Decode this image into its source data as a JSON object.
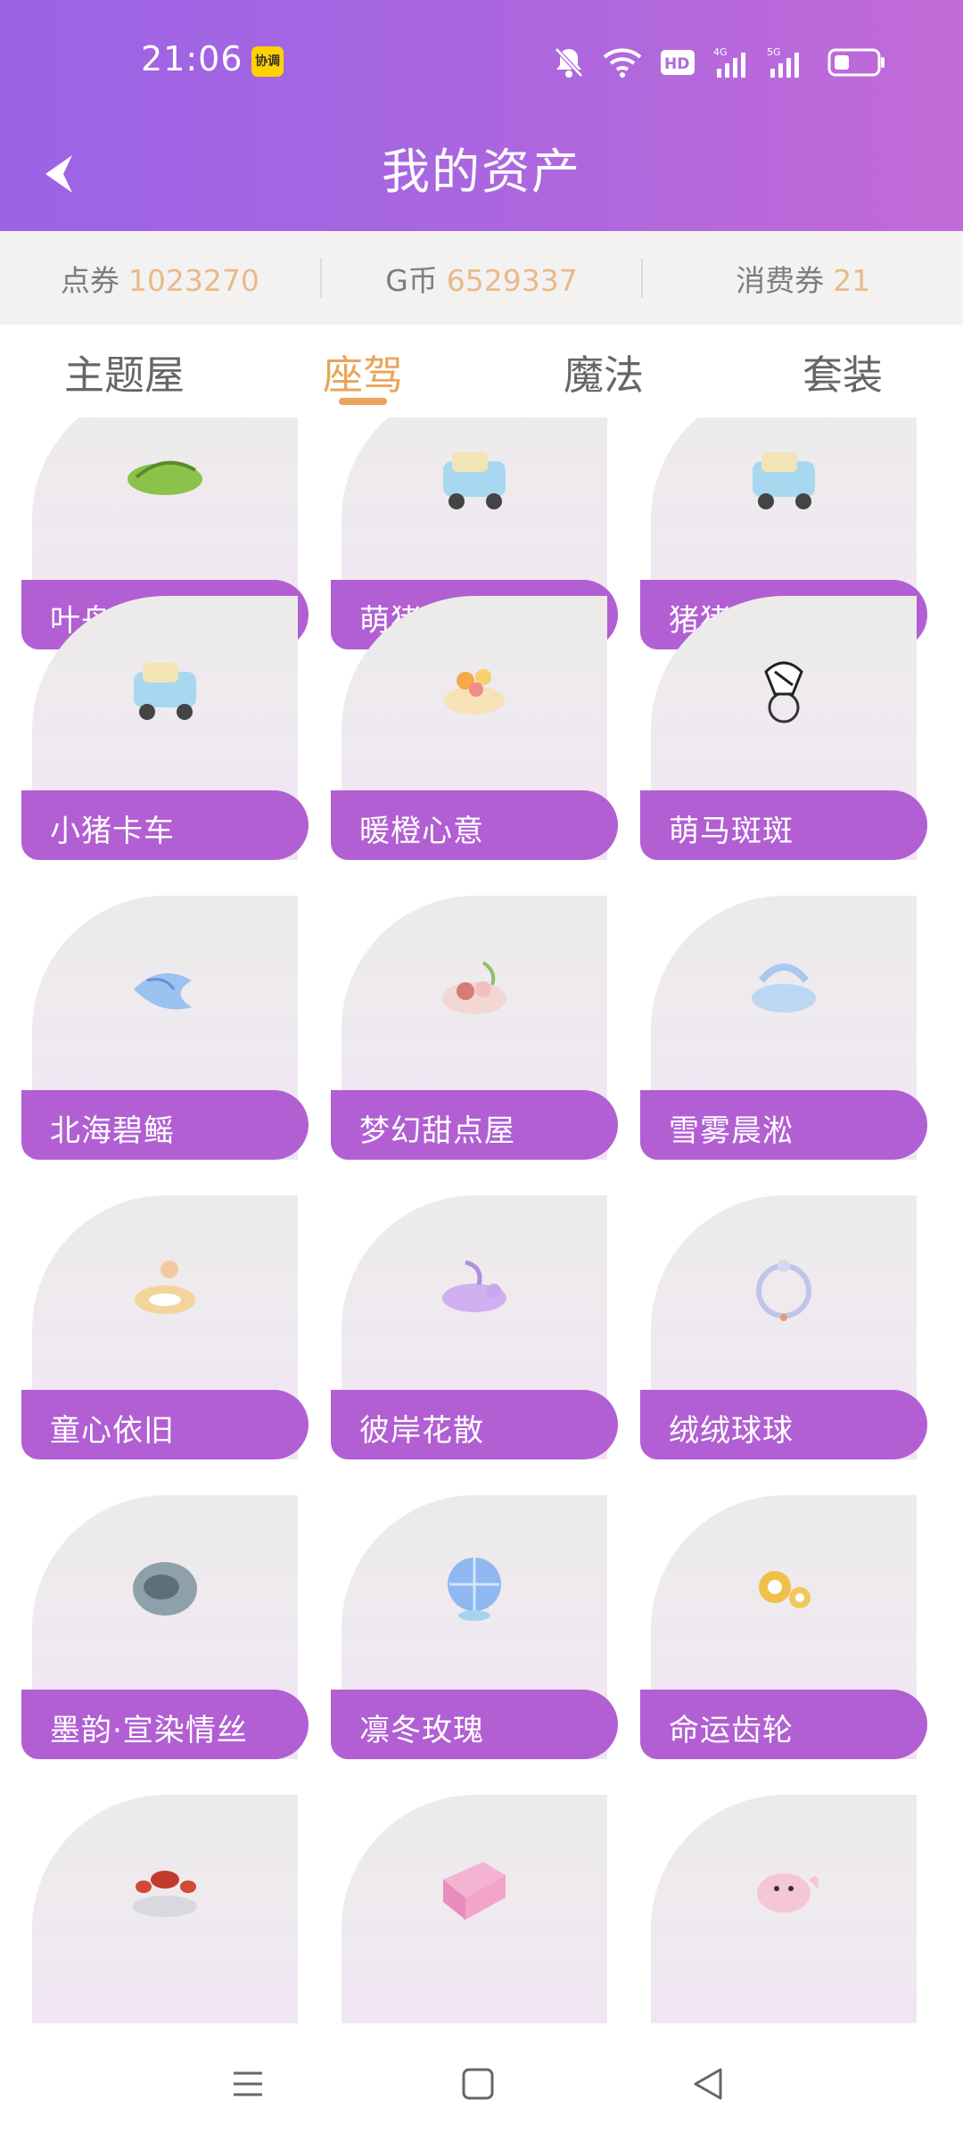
{
  "status": {
    "time": "21:06",
    "app_badge": "协调"
  },
  "header": {
    "title": "我的资产"
  },
  "currencies": [
    {
      "label": "点券",
      "value": "1023270"
    },
    {
      "label": "G币",
      "value": "6529337"
    },
    {
      "label": "消费券",
      "value": "21"
    }
  ],
  "tabs": [
    {
      "label": "主题屋",
      "active": false
    },
    {
      "label": "座驾",
      "active": true
    },
    {
      "label": "魔法",
      "active": false
    },
    {
      "label": "套装",
      "active": false
    }
  ],
  "items": [
    {
      "name": "叶舟飘摇",
      "icon": "leaf-boat-icon"
    },
    {
      "name": "萌猪卡车",
      "icon": "pig-truck-icon"
    },
    {
      "name": "猪猪卡车",
      "icon": "pig-truck-icon"
    },
    {
      "name": "小猪卡车",
      "icon": "pig-truck-icon"
    },
    {
      "name": "暖橙心意",
      "icon": "orange-flower-icon"
    },
    {
      "name": "萌马斑斑",
      "icon": "zebra-icon"
    },
    {
      "name": "北海碧鳐",
      "icon": "blue-fish-icon"
    },
    {
      "name": "梦幻甜点屋",
      "icon": "dessert-icon"
    },
    {
      "name": "雪雾晨淞",
      "icon": "cloud-icon"
    },
    {
      "name": "童心依旧",
      "icon": "float-ring-icon"
    },
    {
      "name": "彼岸花散",
      "icon": "purple-flower-icon"
    },
    {
      "name": "绒绒球球",
      "icon": "fluffy-ball-icon"
    },
    {
      "name": "墨韵·宣染情丝",
      "icon": "ink-swirl-icon"
    },
    {
      "name": "凛冬玫瑰",
      "icon": "ice-globe-icon"
    },
    {
      "name": "命运齿轮",
      "icon": "gear-icon"
    },
    {
      "name": "",
      "icon": "lantern-icon"
    },
    {
      "name": "",
      "icon": "pink-room-icon"
    },
    {
      "name": "",
      "icon": "pink-whale-icon"
    }
  ],
  "colors": {
    "header_start": "#9b63e6",
    "header_end": "#c26ad8",
    "label_purple": "#b15fd3",
    "active_tab": "#e8a65a",
    "currency_value": "#e9b98a"
  }
}
